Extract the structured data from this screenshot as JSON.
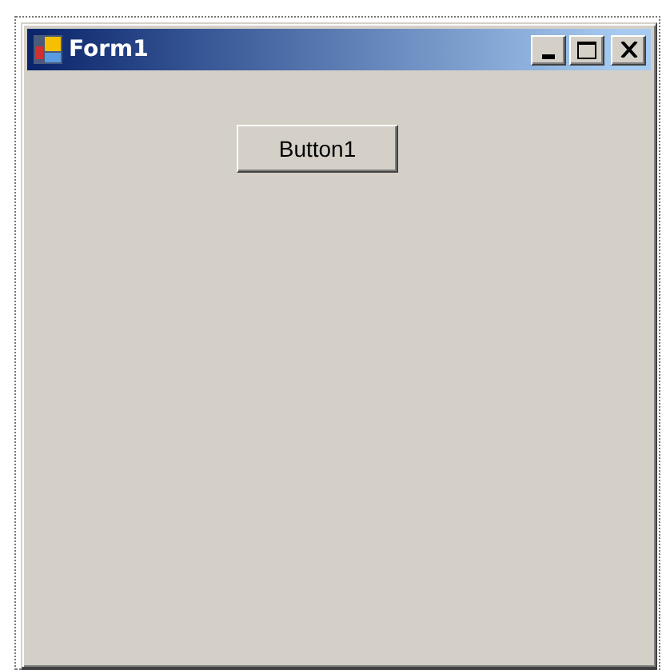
{
  "window": {
    "title": "Form1"
  },
  "buttons": [
    {
      "label": "Button1"
    }
  ]
}
